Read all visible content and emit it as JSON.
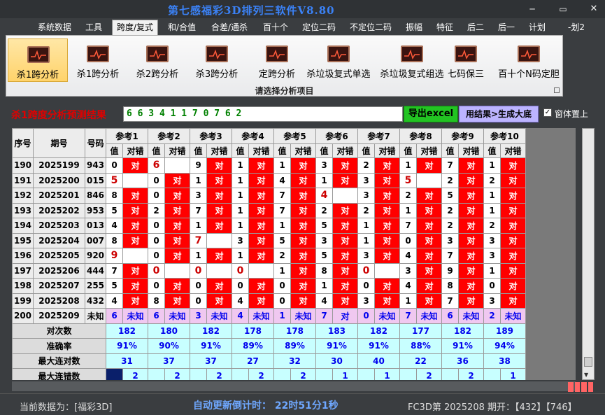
{
  "window": {
    "title": "第七感福彩3D排列三软件V8.80",
    "minimize": "─",
    "maximize": "▭",
    "close": "✕"
  },
  "menu": [
    "系统数据",
    "工具",
    "跨度/复式",
    "和/合值",
    "合差/通杀",
    "百十个",
    "定位二码",
    "不定位二码",
    "振幅",
    "特征",
    "后二",
    "后一",
    "计划",
    "-划2"
  ],
  "menu_active_index": 2,
  "ribbon": {
    "tools": [
      "杀1跨分析",
      "杀1跨分析",
      "杀2跨分析",
      "杀3跨分析",
      "定跨分析",
      "杀垃圾复式单选",
      "杀垃圾复式组选",
      "七码保三",
      "百十个N码定胆"
    ],
    "selected_index": 0,
    "caption": "请选择分析项目"
  },
  "result": {
    "label": "杀1跨度分析预测结果",
    "value": "6 6 3 4 1 1 7 0 7 6 2",
    "export_label": "导出excel",
    "generate_label": "用结果>生成大底",
    "topmost_label": "窗体置上",
    "topmost_checked": "✓"
  },
  "table": {
    "headers": {
      "seq": "序号",
      "period": "期号",
      "number": "号码",
      "value": "值",
      "mark": "对错"
    },
    "refs": [
      "参考1",
      "参考2",
      "参考3",
      "参考4",
      "参考5",
      "参考6",
      "参考7",
      "参考8",
      "参考9",
      "参考10"
    ],
    "rows": [
      {
        "seq": "190",
        "period": "2025199",
        "number": "943",
        "cells": [
          [
            "0",
            "对"
          ],
          [
            "6",
            ""
          ],
          [
            "9",
            "对"
          ],
          [
            "1",
            "对"
          ],
          [
            "1",
            "对"
          ],
          [
            "3",
            "对"
          ],
          [
            "2",
            "对"
          ],
          [
            "1",
            "对"
          ],
          [
            "7",
            "对"
          ],
          [
            "1",
            "对"
          ]
        ]
      },
      {
        "seq": "191",
        "period": "2025200",
        "number": "015",
        "cells": [
          [
            "5",
            ""
          ],
          [
            "0",
            "对"
          ],
          [
            "1",
            "对"
          ],
          [
            "1",
            "对"
          ],
          [
            "4",
            "对"
          ],
          [
            "1",
            "对"
          ],
          [
            "3",
            "对"
          ],
          [
            "5",
            ""
          ],
          [
            "2",
            "对"
          ],
          [
            "2",
            "对"
          ]
        ]
      },
      {
        "seq": "192",
        "period": "2025201",
        "number": "846",
        "cells": [
          [
            "8",
            "对"
          ],
          [
            "0",
            "对"
          ],
          [
            "3",
            "对"
          ],
          [
            "1",
            "对"
          ],
          [
            "7",
            "对"
          ],
          [
            "4",
            ""
          ],
          [
            "3",
            "对"
          ],
          [
            "2",
            "对"
          ],
          [
            "5",
            "对"
          ],
          [
            "1",
            "对"
          ]
        ]
      },
      {
        "seq": "193",
        "period": "2025202",
        "number": "953",
        "cells": [
          [
            "5",
            "对"
          ],
          [
            "2",
            "对"
          ],
          [
            "7",
            "对"
          ],
          [
            "1",
            "对"
          ],
          [
            "7",
            "对"
          ],
          [
            "2",
            "对"
          ],
          [
            "2",
            "对"
          ],
          [
            "1",
            "对"
          ],
          [
            "2",
            "对"
          ],
          [
            "1",
            "对"
          ]
        ]
      },
      {
        "seq": "194",
        "period": "2025203",
        "number": "013",
        "cells": [
          [
            "4",
            "对"
          ],
          [
            "0",
            "对"
          ],
          [
            "1",
            "对"
          ],
          [
            "1",
            "对"
          ],
          [
            "1",
            "对"
          ],
          [
            "5",
            "对"
          ],
          [
            "1",
            "对"
          ],
          [
            "7",
            "对"
          ],
          [
            "2",
            "对"
          ],
          [
            "2",
            "对"
          ]
        ]
      },
      {
        "seq": "195",
        "period": "2025204",
        "number": "007",
        "cells": [
          [
            "8",
            "对"
          ],
          [
            "0",
            "对"
          ],
          [
            "7",
            ""
          ],
          [
            "3",
            "对"
          ],
          [
            "5",
            "对"
          ],
          [
            "3",
            "对"
          ],
          [
            "1",
            "对"
          ],
          [
            "0",
            "对"
          ],
          [
            "3",
            "对"
          ],
          [
            "3",
            "对"
          ]
        ]
      },
      {
        "seq": "196",
        "period": "2025205",
        "number": "920",
        "cells": [
          [
            "9",
            ""
          ],
          [
            "0",
            "对"
          ],
          [
            "1",
            "对"
          ],
          [
            "1",
            "对"
          ],
          [
            "2",
            "对"
          ],
          [
            "5",
            "对"
          ],
          [
            "3",
            "对"
          ],
          [
            "4",
            "对"
          ],
          [
            "7",
            "对"
          ],
          [
            "3",
            "对"
          ]
        ]
      },
      {
        "seq": "197",
        "period": "2025206",
        "number": "444",
        "cells": [
          [
            "7",
            "对"
          ],
          [
            "0",
            ""
          ],
          [
            "0",
            ""
          ],
          [
            "0",
            ""
          ],
          [
            "1",
            "对"
          ],
          [
            "8",
            "对"
          ],
          [
            "0",
            ""
          ],
          [
            "3",
            "对"
          ],
          [
            "9",
            "对"
          ],
          [
            "1",
            "对"
          ]
        ]
      },
      {
        "seq": "198",
        "period": "2025207",
        "number": "255",
        "cells": [
          [
            "5",
            "对"
          ],
          [
            "0",
            "对"
          ],
          [
            "0",
            "对"
          ],
          [
            "0",
            "对"
          ],
          [
            "0",
            "对"
          ],
          [
            "1",
            "对"
          ],
          [
            "0",
            "对"
          ],
          [
            "4",
            "对"
          ],
          [
            "8",
            "对"
          ],
          [
            "0",
            "对"
          ]
        ]
      },
      {
        "seq": "199",
        "period": "2025208",
        "number": "432",
        "cells": [
          [
            "4",
            "对"
          ],
          [
            "8",
            "对"
          ],
          [
            "0",
            "对"
          ],
          [
            "4",
            "对"
          ],
          [
            "0",
            "对"
          ],
          [
            "4",
            "对"
          ],
          [
            "3",
            "对"
          ],
          [
            "1",
            "对"
          ],
          [
            "7",
            "对"
          ],
          [
            "3",
            "对"
          ]
        ]
      }
    ],
    "future_row": {
      "seq": "200",
      "period": "2025209",
      "number": "未知",
      "cells": [
        [
          "6",
          "未知"
        ],
        [
          "6",
          "未知"
        ],
        [
          "3",
          "未知"
        ],
        [
          "4",
          "未知"
        ],
        [
          "1",
          "未知"
        ],
        [
          "7",
          "对"
        ],
        [
          "0",
          "未知"
        ],
        [
          "7",
          "未知"
        ],
        [
          "6",
          "未知"
        ],
        [
          "2",
          "未知"
        ]
      ]
    },
    "stats": [
      {
        "label": "对次数",
        "values": [
          "182",
          "180",
          "182",
          "178",
          "178",
          "183",
          "182",
          "177",
          "182",
          "189"
        ]
      },
      {
        "label": "准确率",
        "values": [
          "91%",
          "90%",
          "91%",
          "89%",
          "89%",
          "91%",
          "91%",
          "88%",
          "91%",
          "94%"
        ]
      },
      {
        "label": "最大连对数",
        "values": [
          "31",
          "37",
          "37",
          "27",
          "32",
          "30",
          "40",
          "22",
          "36",
          "38"
        ]
      },
      {
        "label": "最大连错数",
        "values": [
          "2",
          "2",
          "2",
          "2",
          "2",
          "1",
          "1",
          "2",
          "2",
          "1"
        ]
      }
    ]
  },
  "status": {
    "source": "当前数据为：[福彩3D]",
    "countdown": "自动更新倒计时：  22时51分1秒",
    "draw": "FC3D第 2025208 期开：【432】【746】"
  }
}
